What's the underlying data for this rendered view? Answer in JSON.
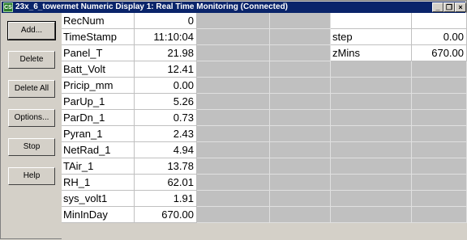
{
  "window": {
    "title": "23x_6_towermet Numeric Display 1: Real Time Monitoring (Connected)",
    "app_icon_text": "CS"
  },
  "buttons": [
    {
      "name": "add-button",
      "label": "Add..."
    },
    {
      "name": "delete-button",
      "label": "Delete"
    },
    {
      "name": "delete-all-button",
      "label": "Delete All"
    },
    {
      "name": "options-button",
      "label": "Options..."
    },
    {
      "name": "stop-button",
      "label": "Stop"
    },
    {
      "name": "help-button",
      "label": "Help"
    }
  ],
  "rows": [
    {
      "label": "RecNum",
      "value": "0"
    },
    {
      "label": "TimeStamp",
      "value": "11:10:04"
    },
    {
      "label": "Panel_T",
      "value": "21.98"
    },
    {
      "label": "Batt_Volt",
      "value": "12.41"
    },
    {
      "label": "Pricip_mm",
      "value": "0.00"
    },
    {
      "label": "ParUp_1",
      "value": "5.26"
    },
    {
      "label": "ParDn_1",
      "value": "0.73"
    },
    {
      "label": "Pyran_1",
      "value": "2.43"
    },
    {
      "label": "NetRad_1",
      "value": "4.94"
    },
    {
      "label": "TAir_1",
      "value": "13.78"
    },
    {
      "label": "RH_1",
      "value": "62.01"
    },
    {
      "label": "sys_volt1",
      "value": "1.91"
    },
    {
      "label": "MinInDay",
      "value": "670.00"
    }
  ],
  "right_rows": [
    {
      "label": "",
      "value": ""
    },
    {
      "label": "step",
      "value": "0.00"
    },
    {
      "label": "zMins",
      "value": "670.00"
    }
  ]
}
